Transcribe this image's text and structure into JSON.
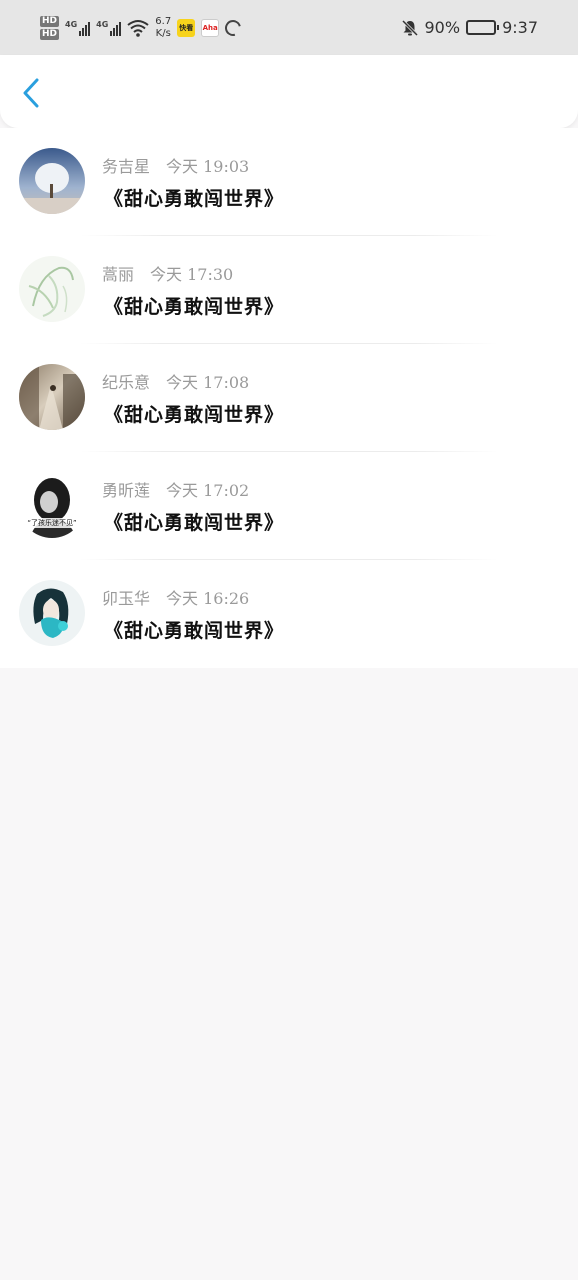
{
  "status_bar": {
    "hd1": "HD",
    "hd2": "HD",
    "net1": "4G",
    "net2": "4G",
    "speed_value": "6.7",
    "speed_unit": "K/s",
    "app_icon1": "快看",
    "app_icon2": "Aha",
    "battery_percent": "90%",
    "time": "9:37",
    "icons": [
      "signal-icon",
      "wifi-icon",
      "loading-ring-icon",
      "mute-bell-icon",
      "battery-icon"
    ]
  },
  "header": {
    "back_icon": "chevron-left-icon",
    "accent_color": "#2a9fde"
  },
  "messages": [
    {
      "name": "务吉星",
      "time": "今天 19:03",
      "text": "《甜心勇敢闯世界》",
      "avatar": "snow-tree-avatar"
    },
    {
      "name": "蒿丽",
      "time": "今天 17:30",
      "text": "《甜心勇敢闯世界》",
      "avatar": "green-sketch-avatar"
    },
    {
      "name": "纪乐意",
      "time": "今天 17:08",
      "text": "《甜心勇敢闯世界》",
      "avatar": "street-photo-avatar"
    },
    {
      "name": "勇昕莲",
      "time": "今天 17:02",
      "text": "《甜心勇敢闯世界》",
      "avatar": "bw-portrait-avatar",
      "avatar_caption": "“了孩乐迷不见”"
    },
    {
      "name": "卯玉华",
      "time": "今天 16:26",
      "text": "《甜心勇敢闯世界》",
      "avatar": "anime-girl-avatar"
    }
  ]
}
